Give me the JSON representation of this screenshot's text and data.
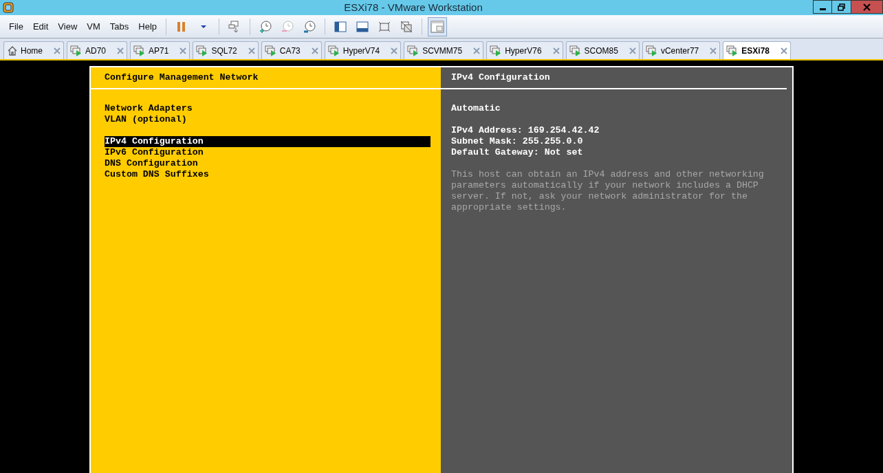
{
  "window": {
    "title": "ESXi78 - VMware Workstation"
  },
  "menu": [
    "File",
    "Edit",
    "View",
    "VM",
    "Tabs",
    "Help"
  ],
  "tabs": [
    {
      "label": "Home",
      "kind": "home",
      "selected": false
    },
    {
      "label": "AD70",
      "kind": "vm",
      "selected": false
    },
    {
      "label": "AP71",
      "kind": "vm",
      "selected": false
    },
    {
      "label": "SQL72",
      "kind": "vm",
      "selected": false
    },
    {
      "label": "CA73",
      "kind": "vm",
      "selected": false
    },
    {
      "label": "HyperV74",
      "kind": "vm",
      "selected": false
    },
    {
      "label": "SCVMM75",
      "kind": "vm",
      "selected": false
    },
    {
      "label": "HyperV76",
      "kind": "vm",
      "selected": false
    },
    {
      "label": "SCOM85",
      "kind": "vm",
      "selected": false
    },
    {
      "label": "vCenter77",
      "kind": "vm",
      "selected": false
    },
    {
      "label": "ESXi78",
      "kind": "vm",
      "selected": true
    }
  ],
  "console": {
    "left": {
      "title": "Configure Management Network",
      "groups": [
        [
          {
            "label": "Network Adapters",
            "selected": false
          },
          {
            "label": "VLAN (optional)",
            "selected": false
          }
        ],
        [
          {
            "label": "IPv4 Configuration",
            "selected": true
          },
          {
            "label": "IPv6 Configuration",
            "selected": false
          },
          {
            "label": "DNS Configuration",
            "selected": false
          },
          {
            "label": "Custom DNS Suffixes",
            "selected": false
          }
        ]
      ]
    },
    "right": {
      "title": "IPv4 Configuration",
      "mode": "Automatic",
      "details": [
        "IPv4 Address: 169.254.42.42",
        "Subnet Mask: 255.255.0.0",
        "Default Gateway: Not set"
      ],
      "description": "This host can obtain an IPv4 address and other networking parameters automatically if your network includes a DHCP server. If not, ask your network administrator for the appropriate settings."
    }
  }
}
